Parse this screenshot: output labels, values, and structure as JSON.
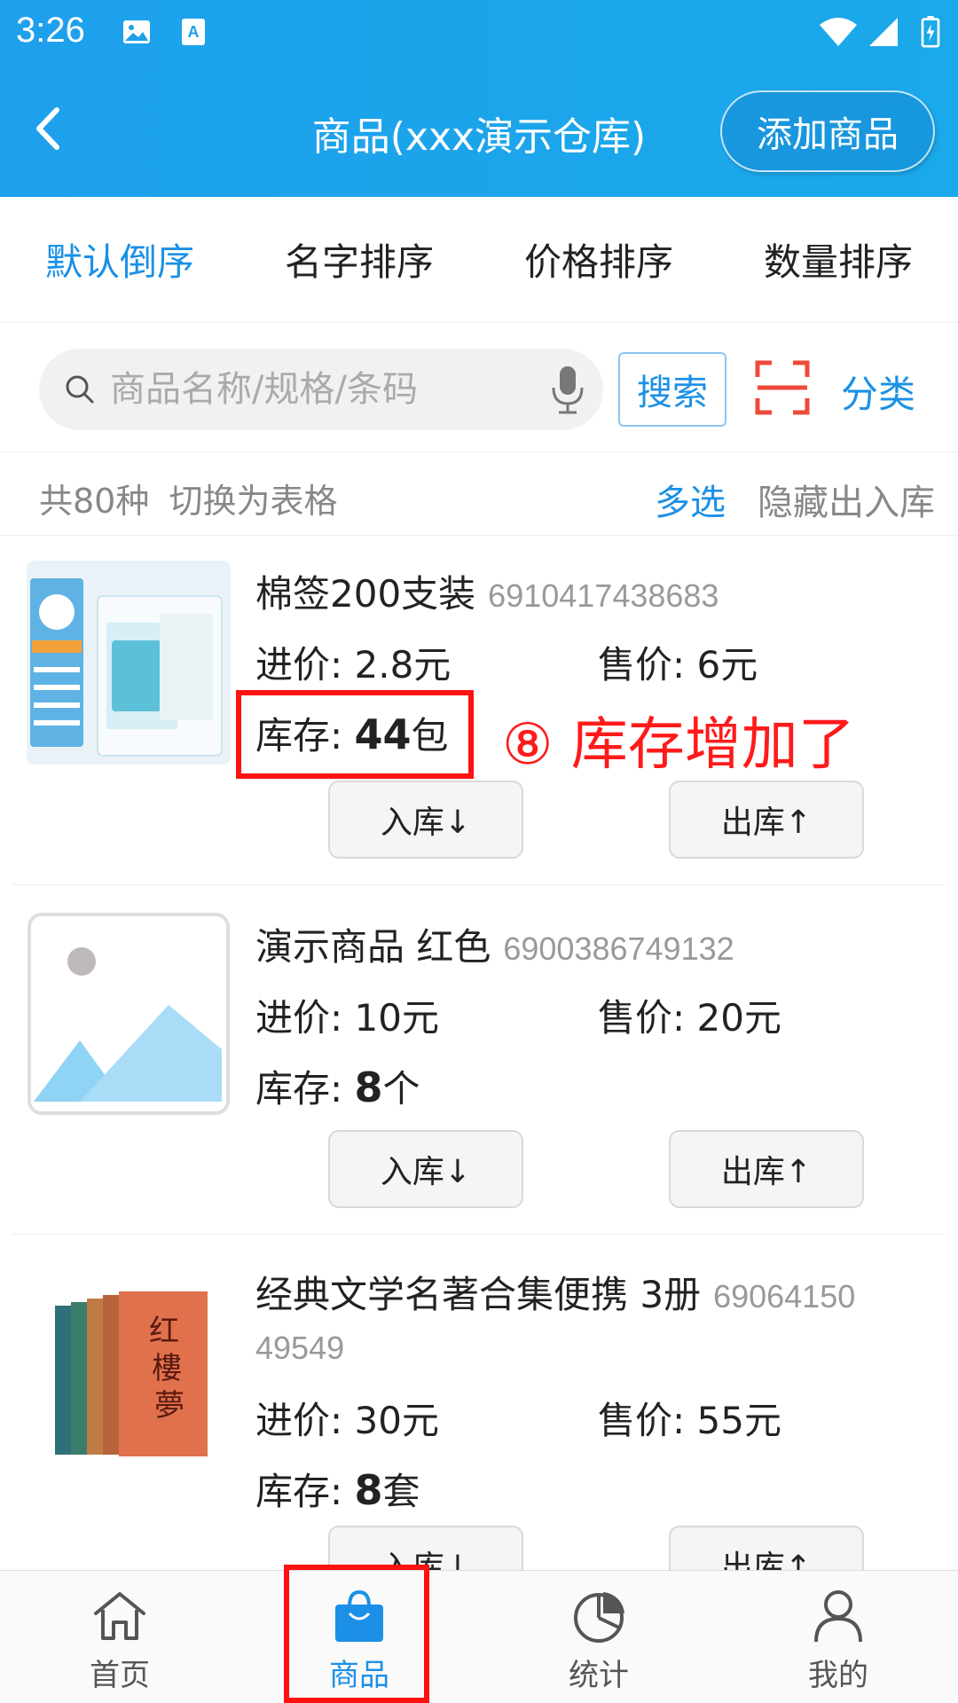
{
  "status": {
    "time": "3:26"
  },
  "header": {
    "title": "商品(xxx演示仓库)",
    "add_button": "添加商品"
  },
  "sort_tabs": [
    {
      "label": "默认倒序",
      "active": true
    },
    {
      "label": "名字排序",
      "active": false
    },
    {
      "label": "价格排序",
      "active": false
    },
    {
      "label": "数量排序",
      "active": false
    }
  ],
  "search": {
    "placeholder": "商品名称/规格/条码",
    "button": "搜索",
    "category": "分类"
  },
  "info": {
    "count_text": "共80种",
    "switch_text": "切换为表格",
    "multi_select": "多选",
    "hide_io": "隐藏出入库"
  },
  "labels": {
    "in_price": "进价:",
    "sale_price": "售价:",
    "stock": "库存:",
    "in_btn": "入库↓",
    "out_btn": "出库↑"
  },
  "products": [
    {
      "name": "棉签200支装",
      "barcode": "6910417438683",
      "in_price": "2.8元",
      "sale_price": "6元",
      "stock_num": "44",
      "stock_unit": "包",
      "thumb": "cotton-swabs"
    },
    {
      "name": "演示商品  红色",
      "barcode": "6900386749132",
      "in_price": "10元",
      "sale_price": "20元",
      "stock_num": "8",
      "stock_unit": "个",
      "thumb": "placeholder"
    },
    {
      "name": "经典文学名著合集便携  3册",
      "barcode_line1": "69064150",
      "barcode_line2": "49549",
      "in_price": "30元",
      "sale_price": "55元",
      "stock_num": "8",
      "stock_unit": "套",
      "thumb": "books"
    }
  ],
  "annotation": {
    "text": "⑧ 库存增加了",
    "color": "#ff1a1a"
  },
  "bottom_nav": [
    {
      "label": "首页",
      "icon": "home-icon",
      "active": false
    },
    {
      "label": "商品",
      "icon": "bag-icon",
      "active": true
    },
    {
      "label": "统计",
      "icon": "pie-chart-icon",
      "active": false
    },
    {
      "label": "我的",
      "icon": "user-icon",
      "active": false
    }
  ],
  "colors": {
    "header": "#1ea0ec",
    "accent": "#1b90e6",
    "highlight": "#ff1111"
  }
}
